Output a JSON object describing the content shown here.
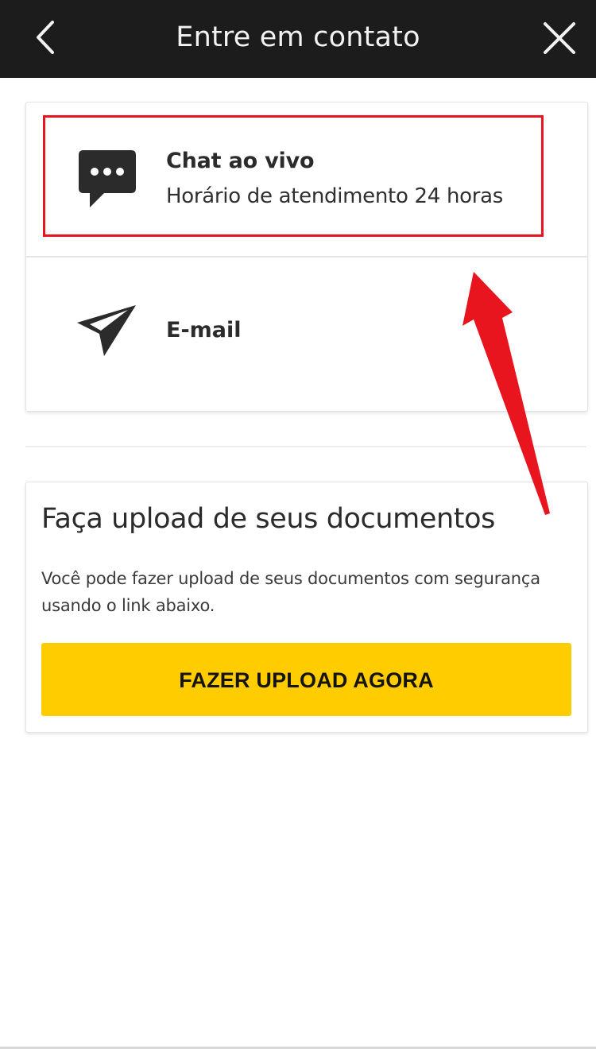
{
  "header": {
    "title": "Entre em contato",
    "back_icon": "chevron-left-icon",
    "close_icon": "close-icon"
  },
  "contact_options": [
    {
      "title": "Chat ao vivo",
      "subtitle": "Horário de atendimento 24 horas",
      "icon": "chat-bubble-icon"
    },
    {
      "title": "E-mail",
      "icon": "paper-plane-icon"
    }
  ],
  "upload": {
    "title": "Faça upload de seus documentos",
    "description": "Você pode fazer upload de seus documentos com segurança usando o link abaixo.",
    "button_label": "FAZER UPLOAD AGORA"
  },
  "colors": {
    "header_bg": "#1c1c1c",
    "accent_yellow": "#ffcc00",
    "annotation_red": "#e8141e",
    "icon_dark": "#2b2b2b"
  }
}
